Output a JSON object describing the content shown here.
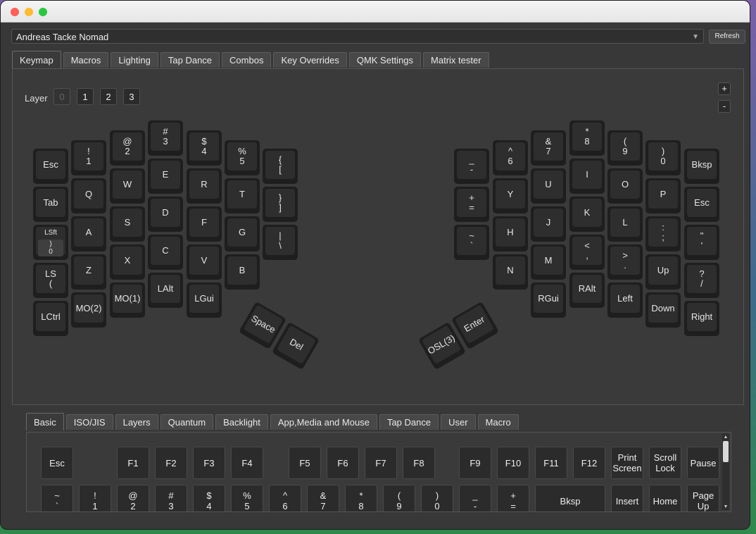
{
  "device": {
    "name": "Andreas Tacke Nomad",
    "refresh_label": "Refresh"
  },
  "main_tabs": [
    {
      "label": "Keymap",
      "active": true
    },
    {
      "label": "Macros"
    },
    {
      "label": "Lighting"
    },
    {
      "label": "Tap Dance"
    },
    {
      "label": "Combos"
    },
    {
      "label": "Key Overrides"
    },
    {
      "label": "QMK Settings"
    },
    {
      "label": "Matrix tester"
    }
  ],
  "layer": {
    "label": "Layer",
    "buttons": [
      "0",
      "1",
      "2",
      "3"
    ],
    "selected": "0"
  },
  "zoom": {
    "plus": "+",
    "minus": "-"
  },
  "keyboard": {
    "left_keys": [
      [
        "Esc",
        "Tab",
        "LSft",
        "LS\n(",
        "LCtrl"
      ],
      [
        "!\n1",
        "Q",
        "A",
        "Z",
        "MO(2)"
      ],
      [
        "@\n2",
        "W",
        "S",
        "X",
        "MO(1)"
      ],
      [
        "#\n3",
        "E",
        "D",
        "C",
        "LAlt"
      ],
      [
        "$\n4",
        "R",
        "F",
        "V",
        "LGui"
      ],
      [
        "%\n5",
        "T",
        "G",
        "B"
      ],
      [
        "{\n[",
        "}\n]",
        "|\n\\"
      ]
    ],
    "lsft_sub": ")\n0",
    "right_keys": [
      [
        "_\n-",
        "+\n=",
        "~\n`"
      ],
      [
        "^\n6",
        "Y",
        "H",
        "N"
      ],
      [
        "&\n7",
        "U",
        "J",
        "M",
        "RGui"
      ],
      [
        "*\n8",
        "I",
        "K",
        "<\n,",
        "RAlt"
      ],
      [
        "(\n9",
        "O",
        "L",
        ">\n.",
        "Left"
      ],
      [
        ")\n0",
        "P",
        ":\n;",
        "Up",
        "Down"
      ],
      [
        "Bksp",
        "Esc",
        "\"\n'",
        "?\n/",
        "Right"
      ]
    ],
    "thumb_left": [
      "Space",
      "Del"
    ],
    "thumb_right": [
      "OSL(3)",
      "Enter"
    ]
  },
  "bottom_tabs": [
    {
      "label": "Basic",
      "active": true
    },
    {
      "label": "ISO/JIS"
    },
    {
      "label": "Layers"
    },
    {
      "label": "Quantum"
    },
    {
      "label": "Backlight"
    },
    {
      "label": "App,Media and Mouse"
    },
    {
      "label": "Tap Dance"
    },
    {
      "label": "User"
    },
    {
      "label": "Macro"
    }
  ],
  "keycodes": {
    "row1": [
      "Esc",
      "F1",
      "F2",
      "F3",
      "F4",
      "F5",
      "F6",
      "F7",
      "F8",
      "F9",
      "F10",
      "F11",
      "F12",
      "Print\nScreen",
      "Scroll\nLock",
      "Pause"
    ],
    "row2": [
      "~\n`",
      "!\n1",
      "@\n2",
      "#\n3",
      "$\n4",
      "%\n5",
      "^\n6",
      "&\n7",
      "*\n8",
      "(\n9",
      ")\n0",
      "_\n-",
      "+\n=",
      "Bksp",
      "Insert",
      "Home",
      "Page\nUp"
    ]
  }
}
